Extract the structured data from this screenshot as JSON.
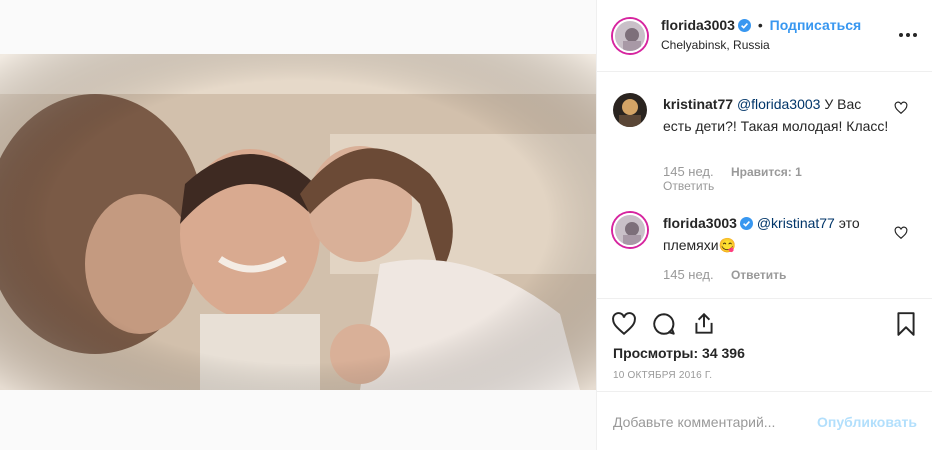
{
  "post": {
    "author": "florida3003",
    "follow_label": "Подписаться",
    "dot": "•",
    "location": "Chelyabinsk, Russia"
  },
  "comments": [
    {
      "username": "kristinat77",
      "mention": "@florida3003",
      "text": " У Вас есть дети?! Такая молодая! Класс!",
      "age": "145 нед.",
      "likes": "Нравится: 1",
      "reply": "Ответить"
    },
    {
      "username": "florida3003",
      "mention": "@kristinat77",
      "text": " это племяхи😋",
      "age": "145 нед.",
      "reply": "Ответить"
    }
  ],
  "stats": {
    "views": "Просмотры: 34 396",
    "date": "10 ОКТЯБРЯ 2016 Г."
  },
  "composer": {
    "placeholder": "Добавьте комментарий...",
    "publish": "Опубликовать"
  },
  "icons": [
    "more-icon",
    "verified-icon",
    "heart-icon",
    "comment-icon",
    "share-icon",
    "bookmark-icon"
  ],
  "colors": {
    "accent": "#3897f0",
    "verified": "#3897f0",
    "muted": "#999999",
    "publish_disabled": "#b2dffc"
  }
}
